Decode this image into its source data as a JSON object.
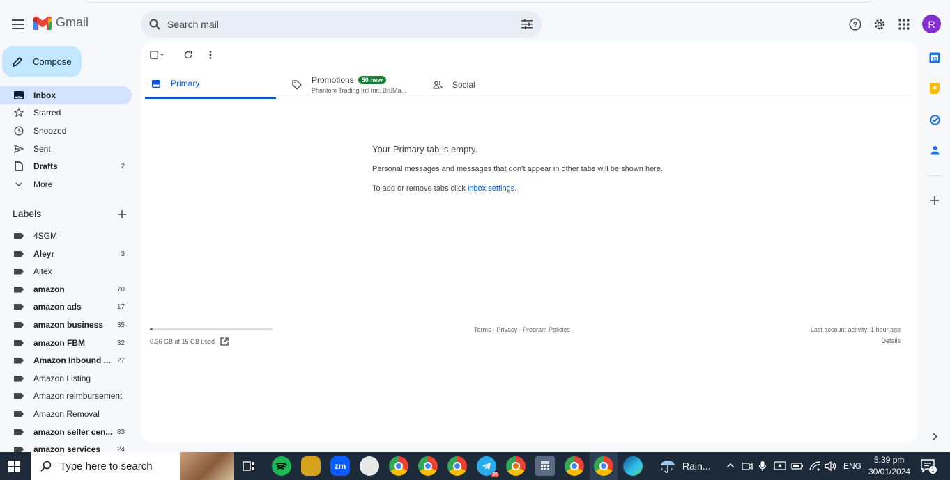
{
  "app": {
    "name": "Gmail"
  },
  "search": {
    "placeholder": "Search mail"
  },
  "header": {
    "avatar_letter": "R"
  },
  "compose": {
    "label": "Compose"
  },
  "nav": [
    {
      "label": "Inbox",
      "count": "",
      "icon": "inbox-icon"
    },
    {
      "label": "Starred",
      "count": "",
      "icon": "star-icon"
    },
    {
      "label": "Snoozed",
      "count": "",
      "icon": "clock-icon"
    },
    {
      "label": "Sent",
      "count": "",
      "icon": "send-icon"
    },
    {
      "label": "Drafts",
      "count": "2",
      "icon": "draft-icon"
    },
    {
      "label": "More",
      "count": "",
      "icon": "chevron-down-icon"
    }
  ],
  "labels": {
    "heading": "Labels",
    "items": [
      {
        "label": "4SGM",
        "count": ""
      },
      {
        "label": "Aleyr",
        "count": "3"
      },
      {
        "label": "Altex",
        "count": ""
      },
      {
        "label": "amazon",
        "count": "70"
      },
      {
        "label": "amazon ads",
        "count": "17"
      },
      {
        "label": "amazon business",
        "count": "35"
      },
      {
        "label": "amazon FBM",
        "count": "32"
      },
      {
        "label": "Amazon Inbound ...",
        "count": "27"
      },
      {
        "label": "Amazon Listing",
        "count": ""
      },
      {
        "label": "Amazon reimbursement",
        "count": ""
      },
      {
        "label": "Amazon Removal",
        "count": ""
      },
      {
        "label": "amazon seller cen...",
        "count": "83"
      },
      {
        "label": "amazon services",
        "count": "24"
      }
    ]
  },
  "tabs": {
    "primary": "Primary",
    "promotions": "Promotions",
    "promotions_badge": "50 new",
    "promotions_sub": "Phantom Trading Intl inc, BrüMa...",
    "social": "Social"
  },
  "empty": {
    "title": "Your Primary tab is empty.",
    "line1": "Personal messages and messages that don’t appear in other tabs will be shown here.",
    "line2_prefix": "To add or remove tabs click ",
    "line2_link": "inbox settings",
    "line2_suffix": "."
  },
  "footer": {
    "storage": "0.36 GB of 15 GB used",
    "storage_fraction": 0.024,
    "links": "Terms · Privacy · Program Policies",
    "activity": "Last account activity: 1 hour ago",
    "details": "Details"
  },
  "taskbar": {
    "search_placeholder": "Type here to search",
    "weather": "Rain...",
    "lang": "ENG",
    "time": "5:39 pm",
    "date": "30/01/2024",
    "notif_count": "1",
    "telegram_badge": "35"
  },
  "colors": {
    "accent": "#0b57d0",
    "compose_bg": "#c2e7ff",
    "active_nav": "#d3e3fd",
    "badge_green": "#188038",
    "avatar": "#8430ce"
  }
}
